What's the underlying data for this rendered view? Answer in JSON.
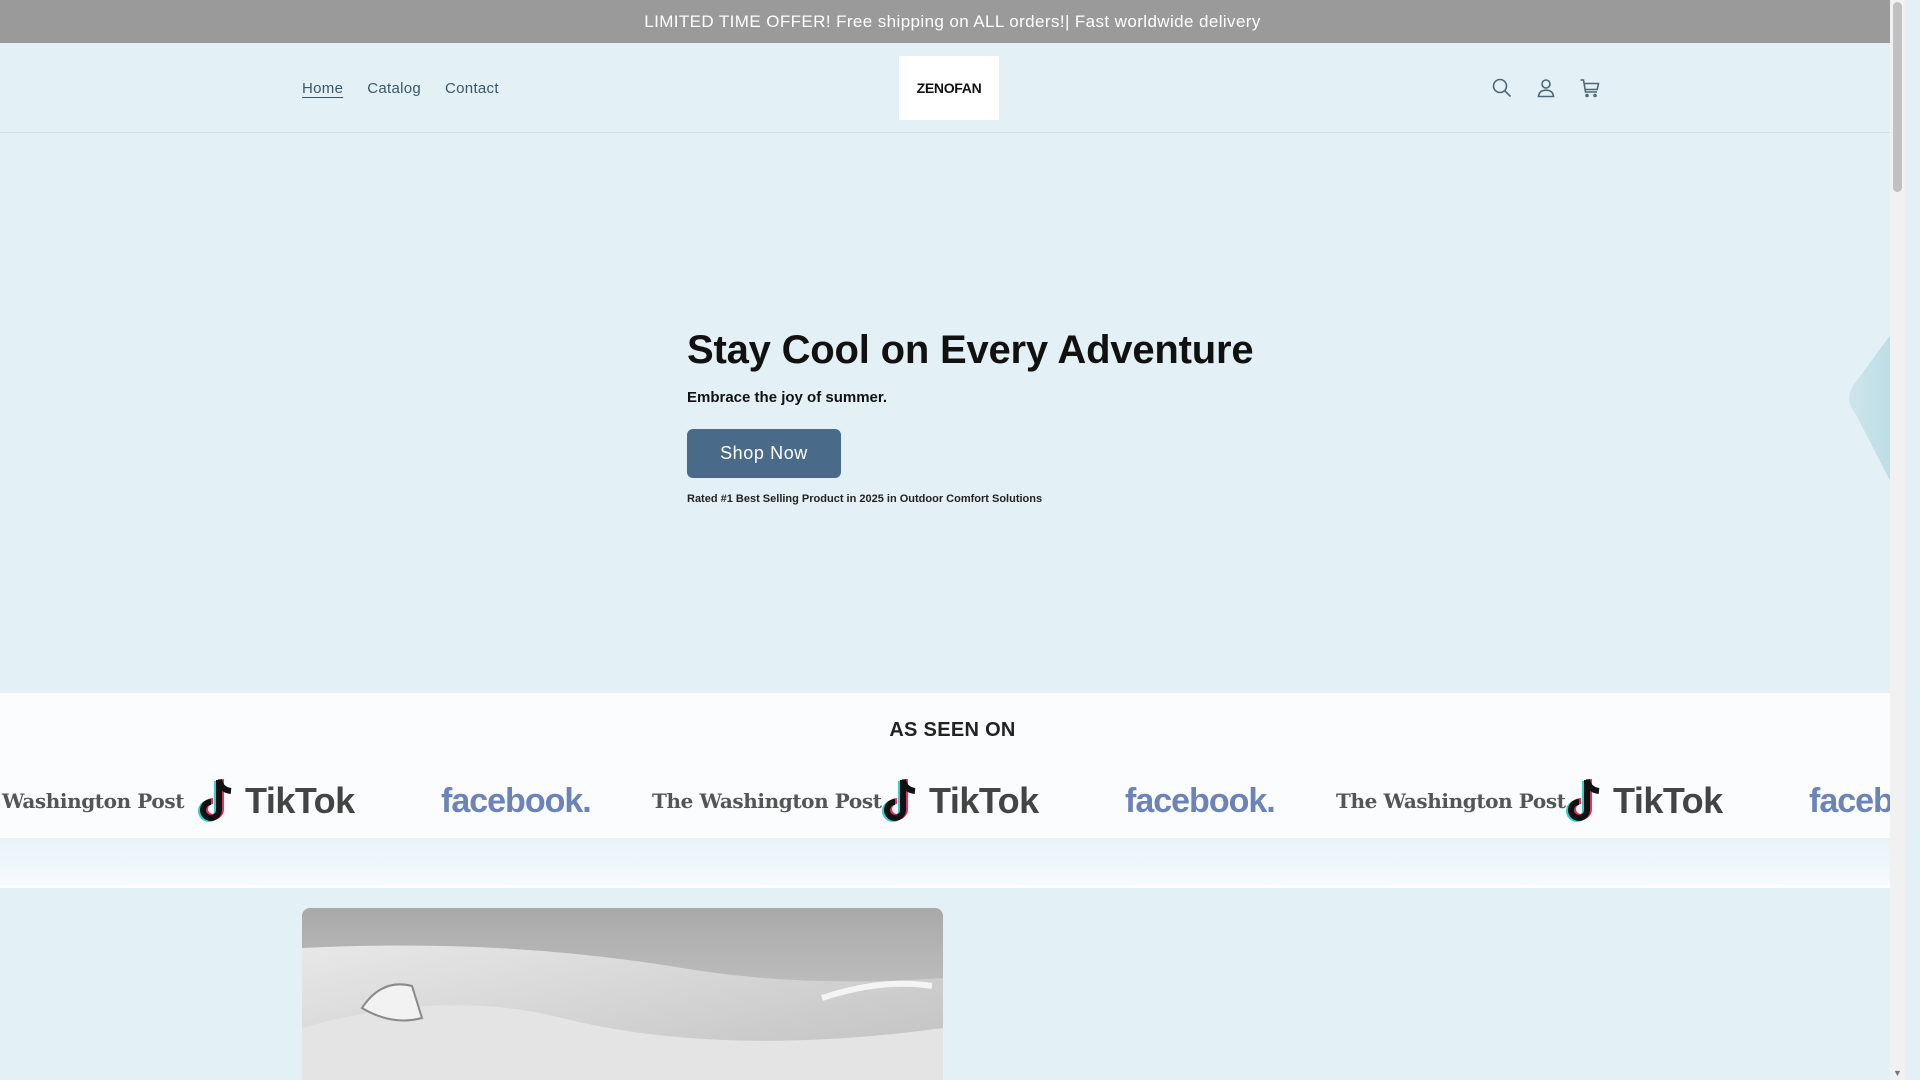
{
  "announcement": {
    "text": "LIMITED TIME OFFER! Free shipping on ALL orders!| Fast worldwide delivery"
  },
  "header": {
    "nav": [
      {
        "label": "Home",
        "active": true
      },
      {
        "label": "Catalog",
        "active": false
      },
      {
        "label": "Contact",
        "active": false
      }
    ],
    "logo": "ZENOFAN",
    "icons": [
      "search-icon",
      "account-icon",
      "cart-icon"
    ]
  },
  "hero": {
    "title": "Stay Cool on Every Adventure",
    "subtitle": "Embrace the joy of summer.",
    "button_label": "Shop Now",
    "note": "Rated #1 Best Selling Product in 2025 in Outdoor Comfort Solutions"
  },
  "as_seen_on": {
    "title": "AS SEEN ON",
    "brands": {
      "washington_post": "The Washington Post",
      "washington_post_partial": "Washington Post",
      "tiktok": "TikTok",
      "facebook": "facebook.",
      "facebook_partial": "facebo"
    }
  },
  "colors": {
    "announcement_bg": "#9a9a9a",
    "page_bg": "#e3f1f7",
    "button_bg": "#4a6a8a",
    "nav_text": "#3c5666"
  }
}
